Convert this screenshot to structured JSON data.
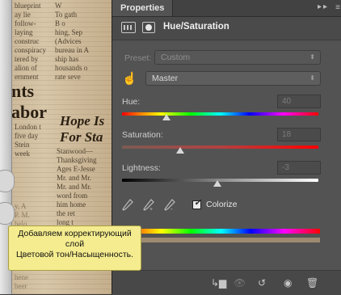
{
  "panel": {
    "tab_label": "Properties",
    "title": "Hue/Saturation",
    "preset_label": "Preset:",
    "preset_value": "Custom",
    "channel_value": "Master",
    "hue": {
      "label": "Hue:",
      "value": "40"
    },
    "saturation": {
      "label": "Saturation:",
      "value": "18"
    },
    "lightness": {
      "label": "Lightness:",
      "value": "-3"
    },
    "colorize_label": "Colorize",
    "colorize_checked": true
  },
  "tooltip": {
    "line1": "Добавляем корректирующий",
    "line2": "слой",
    "line3": "Цветовой тон/Насыщенность."
  },
  "background_text": {
    "col1": "blueprint\nay lie\nfollow-\nlaying\nconstruc\nconspiracy\ntered by\nalion of\nernment",
    "col2": "W\nTo gath\nB o\nhing, Sep\n(Advices\nbureau in A\nship has\nhousands o\nrate seve",
    "headline1": "nts",
    "headline2": "abor",
    "headline3": "Hope Is",
    "headline4": "For Sta",
    "col3": "London t\nfive day\nStein\nweek",
    "col4": "Stanwood—\nThanksgiving\nAges E-Jesse\nMr. and Mr.\nMr. and Mr.\nword from\nhim home\nthe ret\nlong t\nof th",
    "col5": "y, A\nP. M.\nbelo\nof 1\na\nfarm\no, 1\n1023\nhene\nbeer"
  },
  "colors": {
    "panel_bg": "#535353",
    "tooltip_bg": "#f5ec8f",
    "tone_bar": "#9e8a70"
  }
}
